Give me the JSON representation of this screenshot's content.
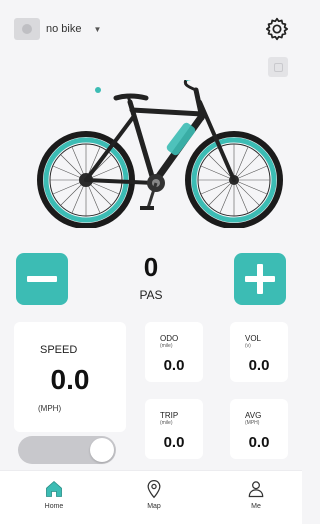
{
  "header": {
    "bike_name": "no bike",
    "bike_thumb_icon": "bike-placeholder-icon",
    "dropdown_icon": "caret-down-icon",
    "settings_icon": "gear-icon"
  },
  "colors": {
    "accent": "#3cbcb4",
    "background": "#f5f5f7",
    "card": "#ffffff",
    "toggle_off": "#c8c8cc"
  },
  "pas": {
    "value": "0",
    "label": "PAS"
  },
  "speed": {
    "label": "SPEED",
    "value": "0.0",
    "unit": "(MPH)"
  },
  "stats": {
    "odo": {
      "label": "ODO",
      "unit": "(mile)",
      "value": "0.0"
    },
    "vol": {
      "label": "VOL",
      "unit": "(v)",
      "value": "0.0"
    },
    "trip": {
      "label": "TRIP",
      "unit": "(mile)",
      "value": "0.0"
    },
    "avg": {
      "label": "AVG",
      "unit": "(MPH)",
      "value": "0.0"
    }
  },
  "toggle": {
    "state": "off"
  },
  "nav": {
    "home": {
      "label": "Home",
      "icon": "home-icon",
      "color": "#3cbcb4"
    },
    "map": {
      "label": "Map",
      "icon": "map-pin-icon"
    },
    "me": {
      "label": "Me",
      "icon": "person-icon"
    }
  }
}
